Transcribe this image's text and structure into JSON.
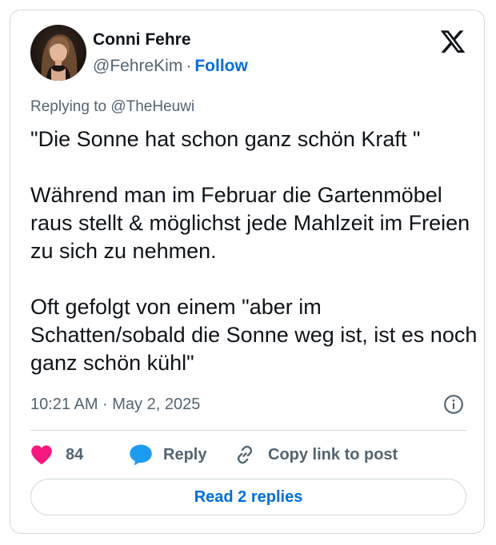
{
  "post": {
    "author_name": "Conni Fehre",
    "handle": "@FehreKim",
    "separator": "·",
    "follow_label": "Follow",
    "replying_to": "Replying to @TheHeuwi",
    "text": "\"Die Sonne hat schon ganz schön Kraft \"\n\nWährend man im Februar die Gartenmöbel raus stellt & möglichst jede Mahlzeit im Freien zu sich zu nehmen.\n\nOft gefolgt von einem \"aber im Schatten/sobald die Sonne weg ist, ist es noch ganz schön kühl\"",
    "timestamp": "10:21 AM · May 2, 2025"
  },
  "actions": {
    "like_count": "84",
    "reply_label": "Reply",
    "copy_link_label": "Copy link to post"
  },
  "footer": {
    "read_replies_label": "Read 2 replies"
  },
  "icons": {
    "logo": "x-logo-icon",
    "info": "info-icon",
    "like": "heart-icon",
    "reply": "speech-bubble-icon",
    "copy": "link-icon"
  },
  "colors": {
    "like": "#f91880",
    "reply_icon": "#1d9bf0",
    "link": "#006fd6",
    "secondary_text": "#536471",
    "border": "#cfd9de"
  }
}
